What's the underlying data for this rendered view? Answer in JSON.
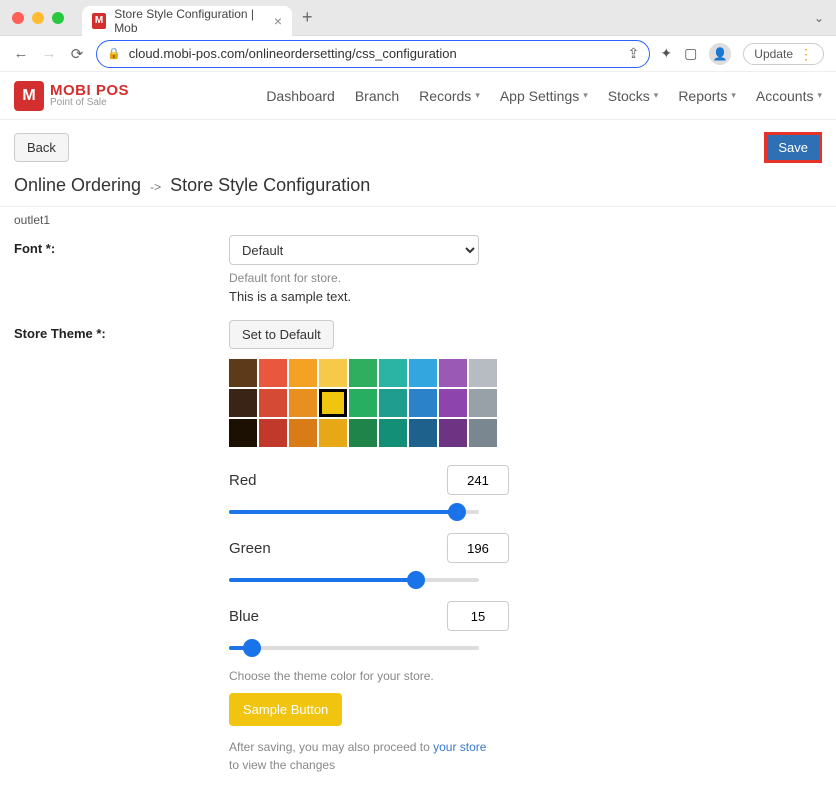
{
  "browser": {
    "tab_title": "Store Style Configuration | Mob",
    "url": "cloud.mobi-pos.com/onlineordersetting/css_configuration",
    "update_label": "Update"
  },
  "logo": {
    "brand": "MOBI POS",
    "tagline": "Point of Sale"
  },
  "nav": {
    "dashboard": "Dashboard",
    "branch": "Branch",
    "records": "Records",
    "app_settings": "App Settings",
    "stocks": "Stocks",
    "reports": "Reports",
    "accounts": "Accounts"
  },
  "toolbar": {
    "back_label": "Back",
    "save_label": "Save"
  },
  "breadcrumb": {
    "parent": "Online Ordering",
    "current": "Store Style Configuration"
  },
  "outlet": "outlet1",
  "font_section": {
    "label": "Font *:",
    "selected": "Default",
    "help": "Default font for store.",
    "sample": "This is a sample text."
  },
  "theme_section": {
    "label": "Store Theme *:",
    "set_default": "Set to Default",
    "palette": [
      {
        "c": "#5d3a1a"
      },
      {
        "c": "#e9573f"
      },
      {
        "c": "#f4a223"
      },
      {
        "c": "#f7c948"
      },
      {
        "c": "#2fae60"
      },
      {
        "c": "#2bb3a3"
      },
      {
        "c": "#34a6df"
      },
      {
        "c": "#9b59b6"
      },
      {
        "c": "#b7bcc2"
      },
      {
        "c": "#3a2416"
      },
      {
        "c": "#d44a34"
      },
      {
        "c": "#e88f1f"
      },
      {
        "c": "#f1c40f",
        "sel": true
      },
      {
        "c": "#27ae60"
      },
      {
        "c": "#1f9e8d"
      },
      {
        "c": "#2c82c9"
      },
      {
        "c": "#8e44ad"
      },
      {
        "c": "#98a0a8"
      },
      {
        "c": "#1c1002"
      },
      {
        "c": "#c0392b"
      },
      {
        "c": "#d97b17"
      },
      {
        "c": "#e6a817"
      },
      {
        "c": "#1e8449"
      },
      {
        "c": "#148f77"
      },
      {
        "c": "#1f618d"
      },
      {
        "c": "#6c3483"
      },
      {
        "c": "#7b8790"
      }
    ],
    "sliders": {
      "red": {
        "label": "Red",
        "value": 241
      },
      "green": {
        "label": "Green",
        "value": 196
      },
      "blue": {
        "label": "Blue",
        "value": 15
      }
    },
    "choose_help": "Choose the theme color for your store.",
    "sample_button": "Sample Button",
    "after_save_pre": "After saving, you may also proceed to ",
    "after_save_link": "your store",
    "after_save_post": " to view the changes"
  }
}
